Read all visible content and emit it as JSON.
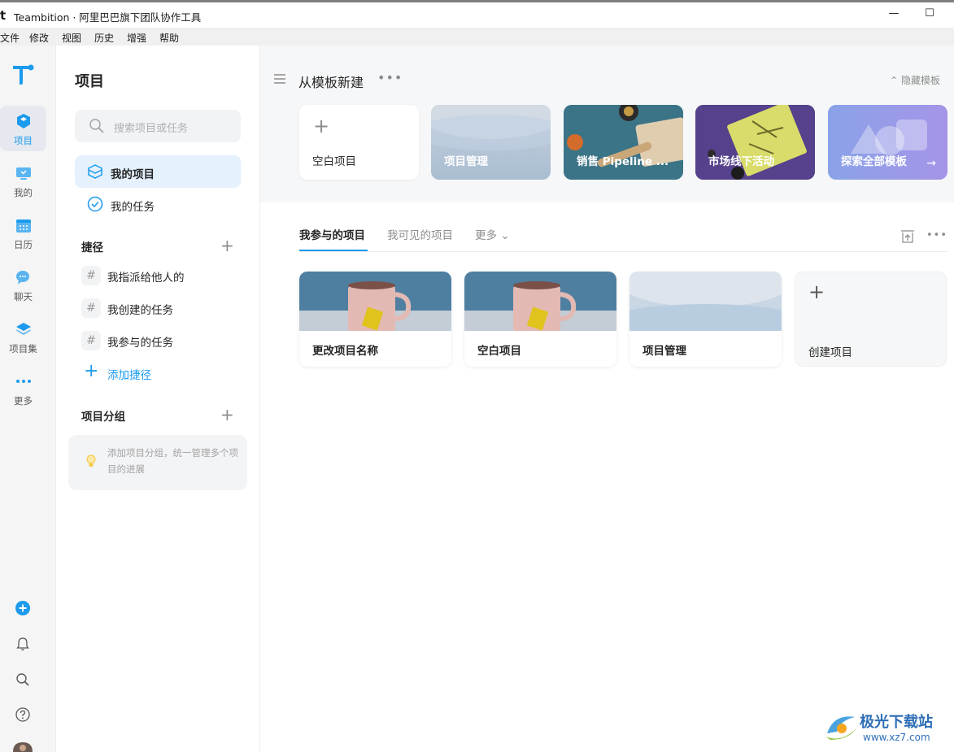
{
  "window": {
    "app_logo": "t",
    "title": "Teambition · 阿里巴巴旗下团队协作工具",
    "minimize": "—",
    "maximize": "☐"
  },
  "menubar": [
    "文件",
    "修改",
    "视图",
    "历史",
    "增强",
    "帮助"
  ],
  "rail": {
    "items": [
      {
        "label": "项目",
        "icon": "project-cube-icon"
      },
      {
        "label": "我的",
        "icon": "my-monitor-icon"
      },
      {
        "label": "日历",
        "icon": "calendar-icon"
      },
      {
        "label": "聊天",
        "icon": "chat-icon"
      },
      {
        "label": "项目集",
        "icon": "layers-icon"
      },
      {
        "label": "更多",
        "icon": "more-dots-icon"
      }
    ]
  },
  "panel": {
    "title": "项目",
    "search_placeholder": "搜索项目或任务",
    "nav": [
      {
        "label": "我的项目"
      },
      {
        "label": "我的任务"
      }
    ],
    "shortcuts_title": "捷径",
    "shortcuts": [
      "我指派给他人的",
      "我创建的任务",
      "我参与的任务"
    ],
    "add_shortcut": "添加捷径",
    "groups_title": "项目分组",
    "groups_hint": "添加项目分组，统一管理多个项目的进展"
  },
  "templates": {
    "heading": "从模板新建",
    "hide": "隐藏模板",
    "cards": [
      {
        "label": "空白项目"
      },
      {
        "label": "项目管理"
      },
      {
        "label": "销售 Pipeline ..."
      },
      {
        "label": "市场线下活动"
      },
      {
        "label": "探索全部模板"
      }
    ]
  },
  "tabs": {
    "items": [
      "我参与的项目",
      "我可见的项目",
      "更多"
    ]
  },
  "projects": [
    {
      "label": "更改项目名称"
    },
    {
      "label": "空白项目"
    },
    {
      "label": "项目管理"
    },
    {
      "label": "创建项目"
    }
  ],
  "watermark": {
    "title": "极光下载站",
    "url": "www.xz7.com"
  },
  "colors": {
    "accent": "#1b9aee",
    "rail_bg": "#f5f5f5",
    "template_bg": "#f6f7f8"
  }
}
